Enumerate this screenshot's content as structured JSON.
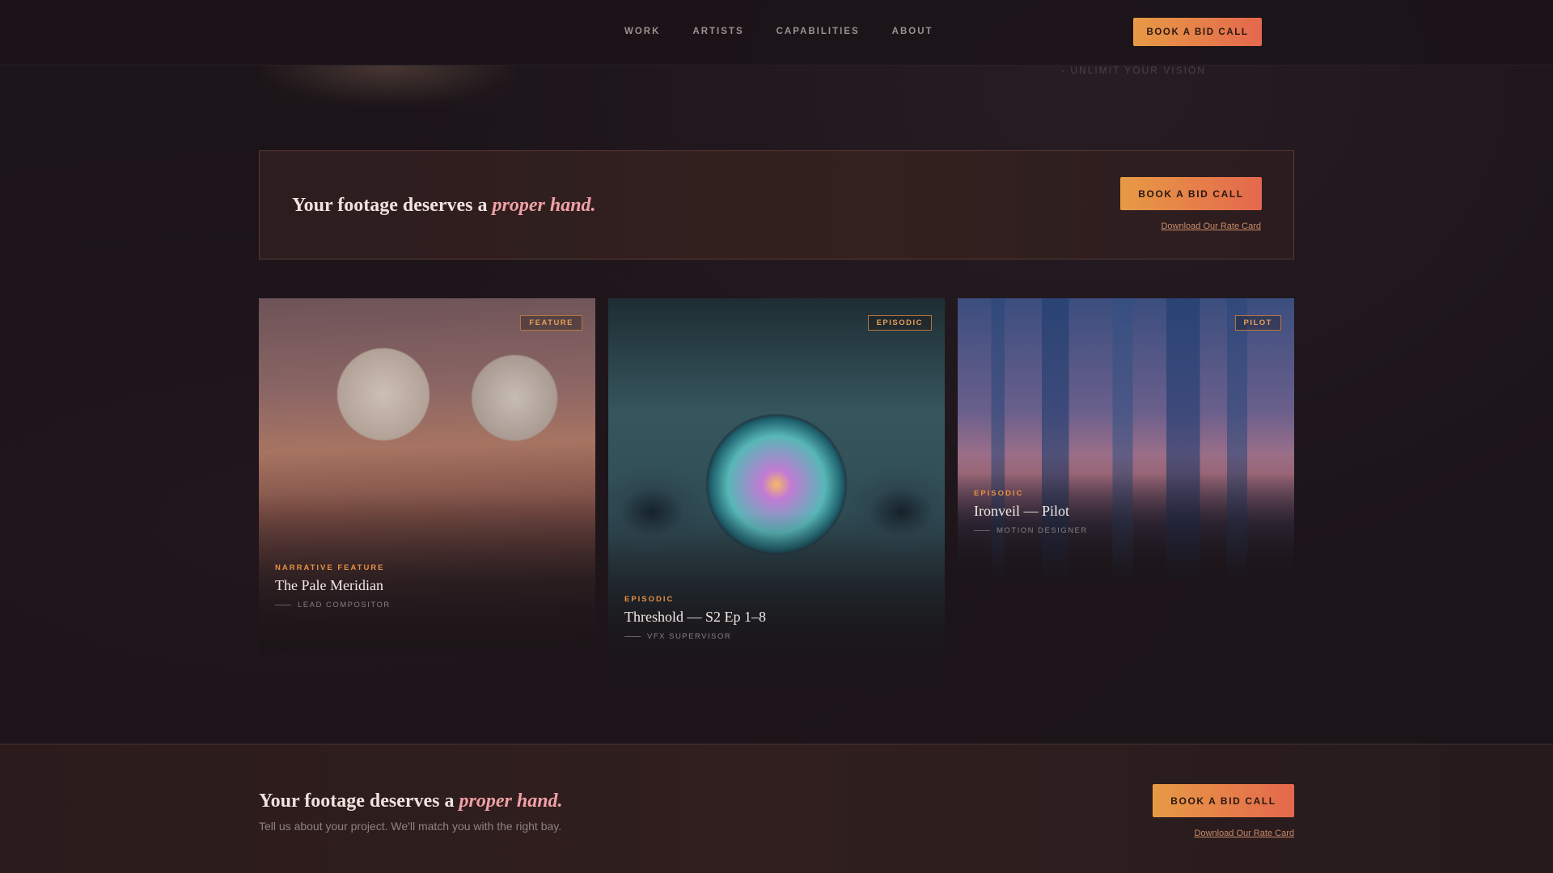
{
  "nav": {
    "items": [
      "WORK",
      "ARTISTS",
      "CAPABILITIES",
      "ABOUT"
    ],
    "cta": "BOOK A BID CALL"
  },
  "hero_remnant": {
    "tagline": "- UNLIMIT YOUR VISION"
  },
  "cta_banner": {
    "headline_pre": "Your footage deserves a",
    "headline_em": "proper hand.",
    "button": "BOOK A BID CALL",
    "link": "Download Our Rate Card"
  },
  "cards": [
    {
      "badge": "FEATURE",
      "category": "NARRATIVE FEATURE",
      "title": "The Pale Meridian",
      "role": "LEAD COMPOSITOR",
      "image": "desert planet landscape with ringed moons"
    },
    {
      "badge": "EPISODIC",
      "category": "EPISODIC",
      "title": "Threshold — S2 Ep 1–8",
      "role": "VFX SUPERVISOR",
      "image": "spaceship corridor with glowing portal"
    },
    {
      "badge": "PILOT",
      "category": "EPISODIC",
      "title": "Ironveil — Pilot",
      "role": "MOTION DESIGNER",
      "image": "futuristic city with flying craft"
    }
  ],
  "footer_cta": {
    "headline_pre": "Your footage deserves a",
    "headline_em": "proper hand.",
    "subtext": "Tell us about your project. We'll match you with the right bay.",
    "button": "BOOK A BID CALL",
    "link": "Download Our Rate Card"
  },
  "colors": {
    "background": "#1b1418",
    "accent_orange": "#e79a45",
    "accent_pink": "#f0a0a6"
  }
}
